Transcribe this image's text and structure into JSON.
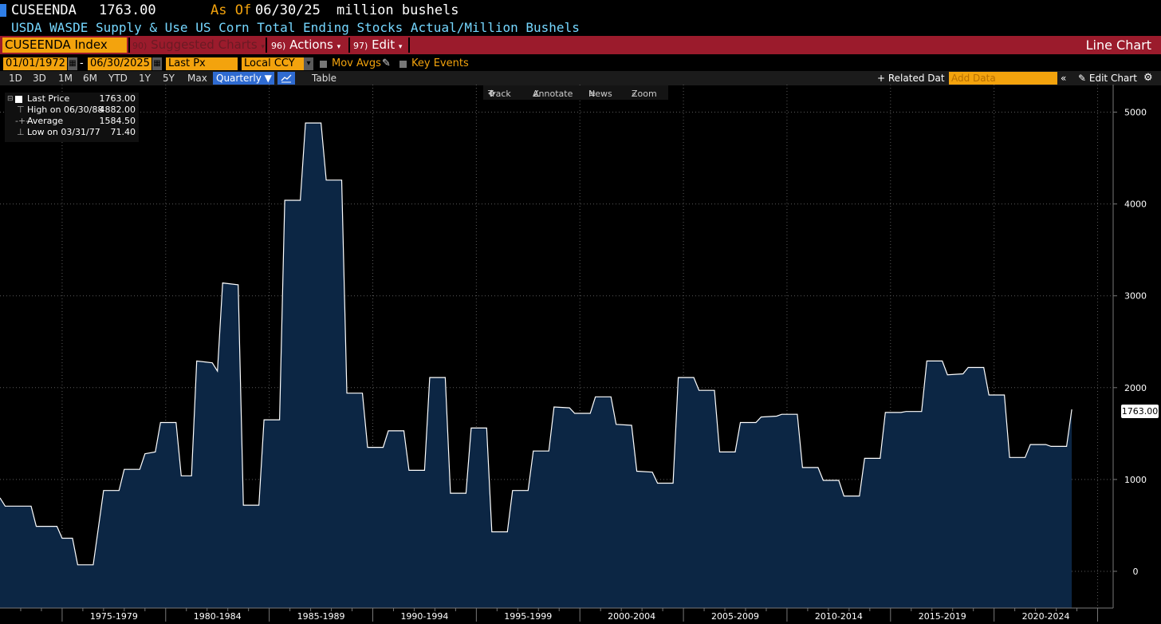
{
  "header": {
    "ticker": "CUSEENDA",
    "last_value": "1763.00",
    "as_of_label": "As Of",
    "as_of_date": "06/30/25",
    "unit": "million bushels",
    "description": "USDA WASDE Supply & Use US Corn Total Ending Stocks Actual/Million Bushels"
  },
  "menu": {
    "security": "CUSEENDA Index",
    "suggested_num": "90)",
    "suggested_label": "Suggested Charts",
    "actions_num": "96)",
    "actions_label": "Actions",
    "edit_num": "97)",
    "edit_label": "Edit",
    "chart_type": "Line Chart"
  },
  "controls": {
    "start_date": "01/01/1972",
    "end_date": "06/30/2025",
    "field": "Last Px",
    "currency": "Local CCY",
    "mov_avgs": "Mov Avgs",
    "key_events": "Key Events"
  },
  "periods": [
    "1D",
    "3D",
    "1M",
    "6M",
    "YTD",
    "1Y",
    "5Y",
    "Max"
  ],
  "frequency": "Quarterly",
  "table_label": "Table",
  "related_data": "+ Related Dat",
  "add_data_placeholder": "Add Data",
  "edit_chart": "Edit Chart",
  "tools": {
    "track": "Track",
    "annotate": "Annotate",
    "news": "News",
    "zoom": "Zoom"
  },
  "legend": [
    {
      "name": "Last Price",
      "value": "1763.00"
    },
    {
      "name": "High on 06/30/88",
      "value": "4882.00"
    },
    {
      "name": "Average",
      "value": "1584.50"
    },
    {
      "name": "Low on 03/31/77",
      "value": "71.40"
    }
  ],
  "colors": {
    "fill": "#0c2644",
    "line": "#ffffff",
    "grid": "#5a5a5a",
    "accent": "#f3a30d",
    "menu_bar": "#9b1b2c"
  },
  "chart_data": {
    "type": "area",
    "x_range": [
      1972,
      2025.75
    ],
    "ylim": [
      -400,
      5300
    ],
    "y_ticks": [
      0,
      1000,
      2000,
      3000,
      4000,
      5000
    ],
    "x_tick_positions": [
      1975,
      1980,
      1985,
      1990,
      1995,
      2000,
      2005,
      2010,
      2015,
      2020
    ],
    "x_labels": [
      "1975-1979",
      "1980-1984",
      "1985-1989",
      "1990-1994",
      "1995-1999",
      "2000-2004",
      "2005-2009",
      "2010-2014",
      "2015-2019",
      "2020-2024"
    ],
    "last_value_label": "1763.00",
    "points": [
      [
        1972.0,
        800
      ],
      [
        1972.25,
        710
      ],
      [
        1973.5,
        710
      ],
      [
        1973.75,
        490
      ],
      [
        1974.75,
        490
      ],
      [
        1975.0,
        360
      ],
      [
        1975.5,
        360
      ],
      [
        1975.75,
        71
      ],
      [
        1976.5,
        71
      ],
      [
        1977.0,
        880
      ],
      [
        1977.75,
        880
      ],
      [
        1978.0,
        1110
      ],
      [
        1978.75,
        1110
      ],
      [
        1979.0,
        1280
      ],
      [
        1979.5,
        1300
      ],
      [
        1979.75,
        1620
      ],
      [
        1980.5,
        1620
      ],
      [
        1980.75,
        1040
      ],
      [
        1981.25,
        1040
      ],
      [
        1981.5,
        2290
      ],
      [
        1982.25,
        2270
      ],
      [
        1982.5,
        2180
      ],
      [
        1982.75,
        3140
      ],
      [
        1983.5,
        3120
      ],
      [
        1983.75,
        720
      ],
      [
        1984.5,
        720
      ],
      [
        1984.75,
        1650
      ],
      [
        1985.5,
        1650
      ],
      [
        1985.75,
        4040
      ],
      [
        1986.5,
        4040
      ],
      [
        1986.75,
        4882
      ],
      [
        1987.5,
        4882
      ],
      [
        1987.75,
        4260
      ],
      [
        1988.5,
        4260
      ],
      [
        1988.75,
        1940
      ],
      [
        1989.5,
        1940
      ],
      [
        1989.75,
        1350
      ],
      [
        1990.5,
        1350
      ],
      [
        1990.75,
        1530
      ],
      [
        1991.5,
        1530
      ],
      [
        1991.75,
        1100
      ],
      [
        1992.5,
        1100
      ],
      [
        1992.75,
        2110
      ],
      [
        1993.5,
        2110
      ],
      [
        1993.75,
        850
      ],
      [
        1994.5,
        850
      ],
      [
        1994.75,
        1560
      ],
      [
        1995.5,
        1560
      ],
      [
        1995.75,
        430
      ],
      [
        1996.5,
        430
      ],
      [
        1996.75,
        880
      ],
      [
        1997.5,
        880
      ],
      [
        1997.75,
        1310
      ],
      [
        1998.5,
        1310
      ],
      [
        1998.75,
        1790
      ],
      [
        1999.5,
        1780
      ],
      [
        1999.75,
        1720
      ],
      [
        2000.5,
        1720
      ],
      [
        2000.75,
        1900
      ],
      [
        2001.5,
        1900
      ],
      [
        2001.75,
        1600
      ],
      [
        2002.5,
        1590
      ],
      [
        2002.75,
        1090
      ],
      [
        2003.5,
        1080
      ],
      [
        2003.75,
        960
      ],
      [
        2004.5,
        960
      ],
      [
        2004.75,
        2110
      ],
      [
        2005.5,
        2110
      ],
      [
        2005.75,
        1970
      ],
      [
        2006.5,
        1970
      ],
      [
        2006.75,
        1300
      ],
      [
        2007.5,
        1300
      ],
      [
        2007.75,
        1620
      ],
      [
        2008.5,
        1620
      ],
      [
        2008.75,
        1680
      ],
      [
        2009.5,
        1690
      ],
      [
        2009.75,
        1710
      ],
      [
        2010.5,
        1710
      ],
      [
        2010.75,
        1130
      ],
      [
        2011.5,
        1130
      ],
      [
        2011.75,
        990
      ],
      [
        2012.5,
        990
      ],
      [
        2012.75,
        820
      ],
      [
        2013.5,
        820
      ],
      [
        2013.75,
        1230
      ],
      [
        2014.5,
        1230
      ],
      [
        2014.75,
        1730
      ],
      [
        2015.5,
        1730
      ],
      [
        2015.75,
        1740
      ],
      [
        2016.5,
        1740
      ],
      [
        2016.75,
        2290
      ],
      [
        2017.5,
        2290
      ],
      [
        2017.75,
        2140
      ],
      [
        2018.5,
        2150
      ],
      [
        2018.75,
        2220
      ],
      [
        2019.5,
        2220
      ],
      [
        2019.75,
        1920
      ],
      [
        2020.5,
        1920
      ],
      [
        2020.75,
        1240
      ],
      [
        2021.5,
        1240
      ],
      [
        2021.75,
        1380
      ],
      [
        2022.5,
        1380
      ],
      [
        2022.75,
        1360
      ],
      [
        2023.5,
        1360
      ],
      [
        2023.75,
        1763
      ]
    ]
  }
}
